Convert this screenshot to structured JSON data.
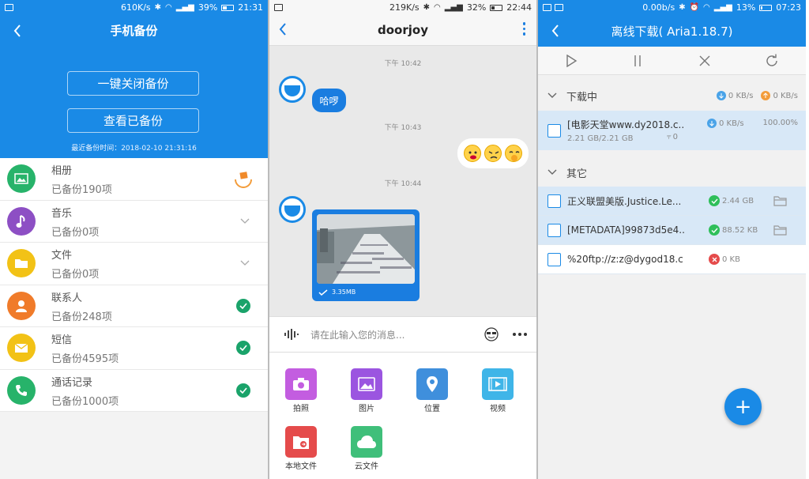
{
  "panel1": {
    "status": {
      "speed": "610K/s",
      "battery": "39%",
      "time": "21:31"
    },
    "title": "手机备份",
    "btn_close": "一键关闭备份",
    "btn_view": "查看已备份",
    "last_backup": "最近备份时间：2018-02-10 21:31:16",
    "items": [
      {
        "name": "相册",
        "status": "已备份190项",
        "color": "#27b36a",
        "icon": "image-icon",
        "right": "syncing"
      },
      {
        "name": "音乐",
        "status": "已备份0项",
        "color": "#8d4fc4",
        "icon": "music-icon",
        "right": "chevron"
      },
      {
        "name": "文件",
        "status": "已备份0项",
        "color": "#f2c216",
        "icon": "folder-icon",
        "right": "chevron"
      },
      {
        "name": "联系人",
        "status": "已备份248项",
        "color": "#f07b2a",
        "icon": "person-icon",
        "right": "check"
      },
      {
        "name": "短信",
        "status": "已备份4595项",
        "color": "#f2c216",
        "icon": "mail-icon",
        "right": "check"
      },
      {
        "name": "通话记录",
        "status": "已备份1000项",
        "color": "#27b36a",
        "icon": "phone-icon",
        "right": "check"
      }
    ]
  },
  "panel2": {
    "status": {
      "speed": "219K/s",
      "battery": "32%",
      "time": "22:44"
    },
    "title": "doorjoy",
    "times": [
      "下午 10:42",
      "下午 10:43",
      "下午 10:44"
    ],
    "msg1": "哈啰",
    "img_size": "3.35MB",
    "input_placeholder": "请在此输入您的消息...",
    "tools": [
      {
        "label": "拍照",
        "color": "#c35de0",
        "icon": "camera-icon"
      },
      {
        "label": "图片",
        "color": "#9b55e0",
        "icon": "picture-icon"
      },
      {
        "label": "位置",
        "color": "#3f8fdc",
        "icon": "location-icon"
      },
      {
        "label": "视频",
        "color": "#3fb5e8",
        "icon": "video-icon"
      },
      {
        "label": "本地文件",
        "color": "#e54b4b",
        "icon": "local-file-icon"
      },
      {
        "label": "云文件",
        "color": "#3fbf7a",
        "icon": "cloud-file-icon"
      }
    ]
  },
  "panel3": {
    "status": {
      "speed": "0.00b/s",
      "battery": "13%",
      "time": "07:23"
    },
    "title": "离线下载( Aria1.18.7)",
    "downloading": {
      "label": "下载中",
      "down": "0 KB/s",
      "up": "0 KB/s"
    },
    "active": {
      "name": "[电影天堂www.dy2018.c...",
      "speed": "0 KB/s",
      "percent": "100.00%",
      "size": "2.21 GB/2.21 GB",
      "conns": "0"
    },
    "other_label": "其它",
    "others": [
      {
        "name": "正义联盟美版.Justice.Le...",
        "size": "2.44 GB",
        "status": "done"
      },
      {
        "name": "[METADATA]99873d5e4...",
        "size": "88.52 KB",
        "status": "done"
      },
      {
        "name": "%20ftp://z:z@dygod18.c...",
        "size": "0 KB",
        "status": "error"
      }
    ]
  }
}
